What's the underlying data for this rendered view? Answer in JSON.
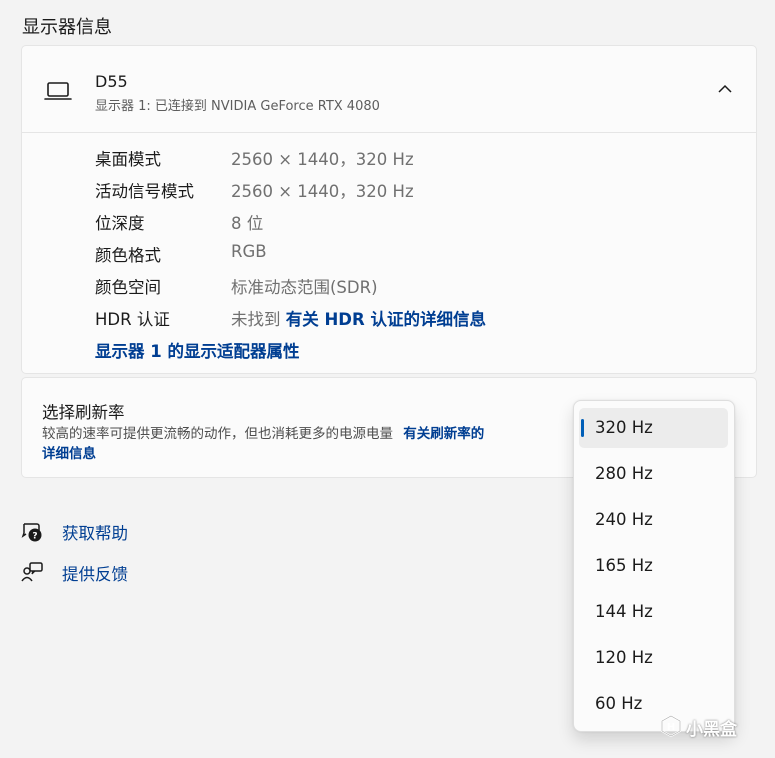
{
  "page": {
    "title": "显示器信息"
  },
  "display": {
    "name": "D55",
    "subtitle": "显示器 1: 已连接到 NVIDIA GeForce RTX 4080",
    "properties": [
      {
        "label": "桌面模式",
        "value": "2560 × 1440，320 Hz"
      },
      {
        "label": "活动信号模式",
        "value": "2560 × 1440，320 Hz"
      },
      {
        "label": "位深度",
        "value": "8 位"
      },
      {
        "label": "颜色格式",
        "value": "RGB"
      },
      {
        "label": "颜色空间",
        "value": "标准动态范围(SDR)"
      },
      {
        "label": "HDR 认证",
        "value": "未找到",
        "link": "有关 HDR 认证的详细信息"
      }
    ],
    "adapter_link": "显示器 1 的显示适配器属性"
  },
  "refresh": {
    "title": "选择刷新率",
    "description": "较高的速率可提供更流畅的动作，但也消耗更多的电源电量",
    "link_part1": "有关刷新率的",
    "link_part2": "详细信息"
  },
  "help": {
    "get_help": "获取帮助",
    "feedback": "提供反馈"
  },
  "dropdown": {
    "selected": "320 Hz",
    "options": [
      "320 Hz",
      "280 Hz",
      "240 Hz",
      "165 Hz",
      "144 Hz",
      "120 Hz",
      "60 Hz"
    ]
  },
  "watermark": {
    "text": "小黑盒"
  },
  "colors": {
    "accent": "#005fb8",
    "link": "#003e92"
  }
}
